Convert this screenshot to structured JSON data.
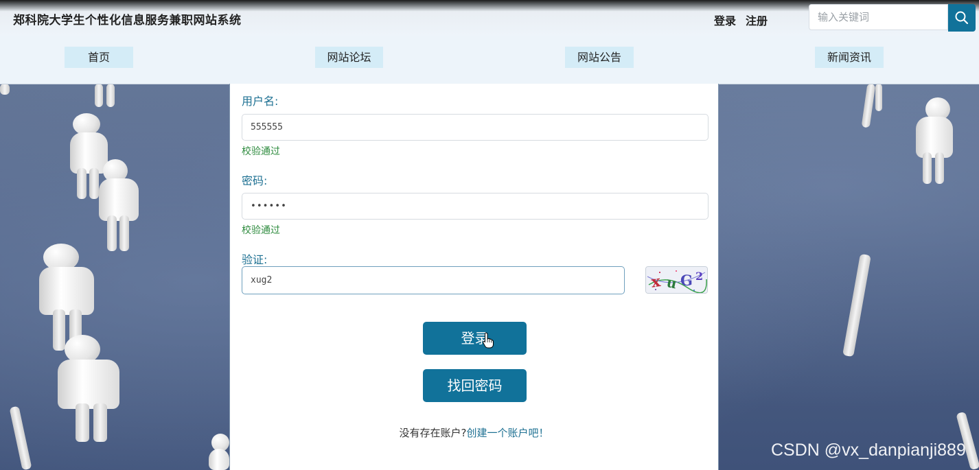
{
  "header": {
    "site_title": "郑科院大学生个性化信息服务兼职网站系统",
    "login_link": "登录",
    "register_link": "注册",
    "search_placeholder": "输入关键词"
  },
  "nav": {
    "items": [
      {
        "label": "首页"
      },
      {
        "label": "网站论坛"
      },
      {
        "label": "网站公告"
      },
      {
        "label": "新闻资讯"
      }
    ]
  },
  "login_form": {
    "username_label": "用户名:",
    "username_value": "555555",
    "username_status": "校验通过",
    "password_label": "密码:",
    "password_value": "••••••",
    "password_status": "校验通过",
    "captcha_label": "验证:",
    "captcha_value": "xug2",
    "captcha_image_text": "xuG2",
    "login_button": "登录",
    "recover_button": "找回密码",
    "no_account_text": "没有存在账户?",
    "create_account_link": "创建一个账户吧！"
  },
  "colors": {
    "accent": "#11729a",
    "label": "#1d7092",
    "valid": "#2e8b3e",
    "nav_item_bg": "#d4ecf7"
  },
  "icons": {
    "search": "search-icon",
    "cursor": "hand-pointer-icon"
  },
  "watermark": "CSDN @vx_danpianji889"
}
